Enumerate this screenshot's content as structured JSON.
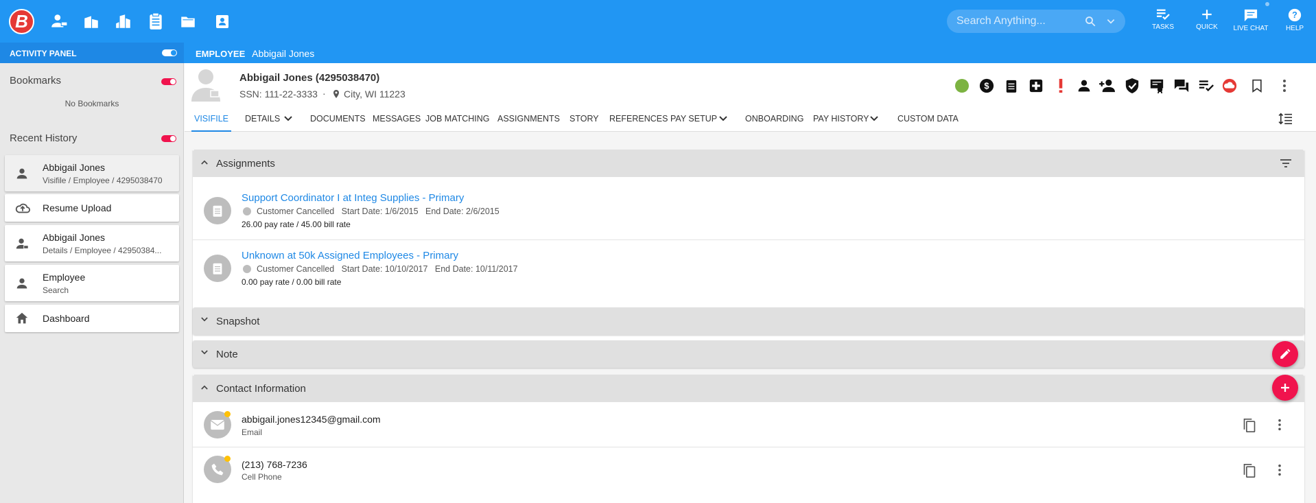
{
  "app": {
    "logo": "B"
  },
  "topnav": {
    "icons": [
      "person-icon",
      "building-icon",
      "buildings-icon",
      "clipboard-icon",
      "folder-icon",
      "badge-icon"
    ],
    "search_placeholder": "Search Anything...",
    "buttons": [
      {
        "label": "TASKS",
        "icon": "tasks-icon"
      },
      {
        "label": "QUICK",
        "icon": "plus-icon"
      },
      {
        "label": "LIVE CHAT",
        "icon": "chat-icon"
      },
      {
        "label": "HELP",
        "icon": "help-icon"
      }
    ]
  },
  "activity_panel": {
    "title": "ACTIVITY PANEL"
  },
  "sidebar": {
    "bookmarks_title": "Bookmarks",
    "bookmarks_empty": "No Bookmarks",
    "recent_title": "Recent History",
    "history": [
      {
        "title": "Abbigail Jones",
        "sub": "Visifile / Employee / 4295038470",
        "icon": "person-icon"
      },
      {
        "title": "Resume Upload",
        "sub": "",
        "icon": "cloud-upload-icon"
      },
      {
        "title": "Abbigail Jones",
        "sub": "Details / Employee / 42950384...",
        "icon": "person-card-icon"
      },
      {
        "title": "Employee",
        "sub": "Search",
        "icon": "person-icon"
      },
      {
        "title": "Dashboard",
        "sub": "",
        "icon": "home-icon"
      }
    ]
  },
  "header": {
    "entity": "EMPLOYEE",
    "name": "Abbigail Jones"
  },
  "profile": {
    "name": "Abbigail Jones (4295038470)",
    "ssn": "SSN: 111-22-3333",
    "separator": "·",
    "location": "City, WI 11223",
    "status_color": "#7cb342"
  },
  "tabs": [
    {
      "label": "VISIFILE",
      "active": true
    },
    {
      "label": "DETAILS",
      "dropdown": true
    },
    {
      "label": "DOCUMENTS"
    },
    {
      "label": "MESSAGES"
    },
    {
      "label": "JOB MATCHING"
    },
    {
      "label": "ASSIGNMENTS"
    },
    {
      "label": "STORY"
    },
    {
      "label": "REFERENCES"
    },
    {
      "label": "PAY SETUP",
      "dropdown": true
    },
    {
      "label": "ONBOARDING"
    },
    {
      "label": "PAY HISTORY",
      "dropdown": true
    },
    {
      "label": "CUSTOM DATA"
    }
  ],
  "assignments": {
    "title": "Assignments",
    "items": [
      {
        "title": "Support Coordinator I at Integ Supplies - Primary",
        "status": "Customer Cancelled",
        "start": "Start Date: 1/6/2015",
        "end": "End Date: 2/6/2015",
        "rate": "26.00 pay rate / 45.00 bill rate"
      },
      {
        "title": "Unknown at 50k Assigned Employees - Primary",
        "status": "Customer Cancelled",
        "start": "Start Date: 10/10/2017",
        "end": "End Date: 10/11/2017",
        "rate": "0.00 pay rate / 0.00 bill rate"
      }
    ]
  },
  "panels": {
    "snapshot": "Snapshot",
    "note": "Note",
    "contact": "Contact Information"
  },
  "contacts": [
    {
      "value": "abbigail.jones12345@gmail.com",
      "type": "Email",
      "icon": "mail-icon"
    },
    {
      "value": "(213) 768-7236",
      "type": "Cell Phone",
      "icon": "phone-icon"
    }
  ],
  "colors": {
    "primary": "#2196f3",
    "accent": "#f0134d",
    "link": "#1e88e5"
  }
}
